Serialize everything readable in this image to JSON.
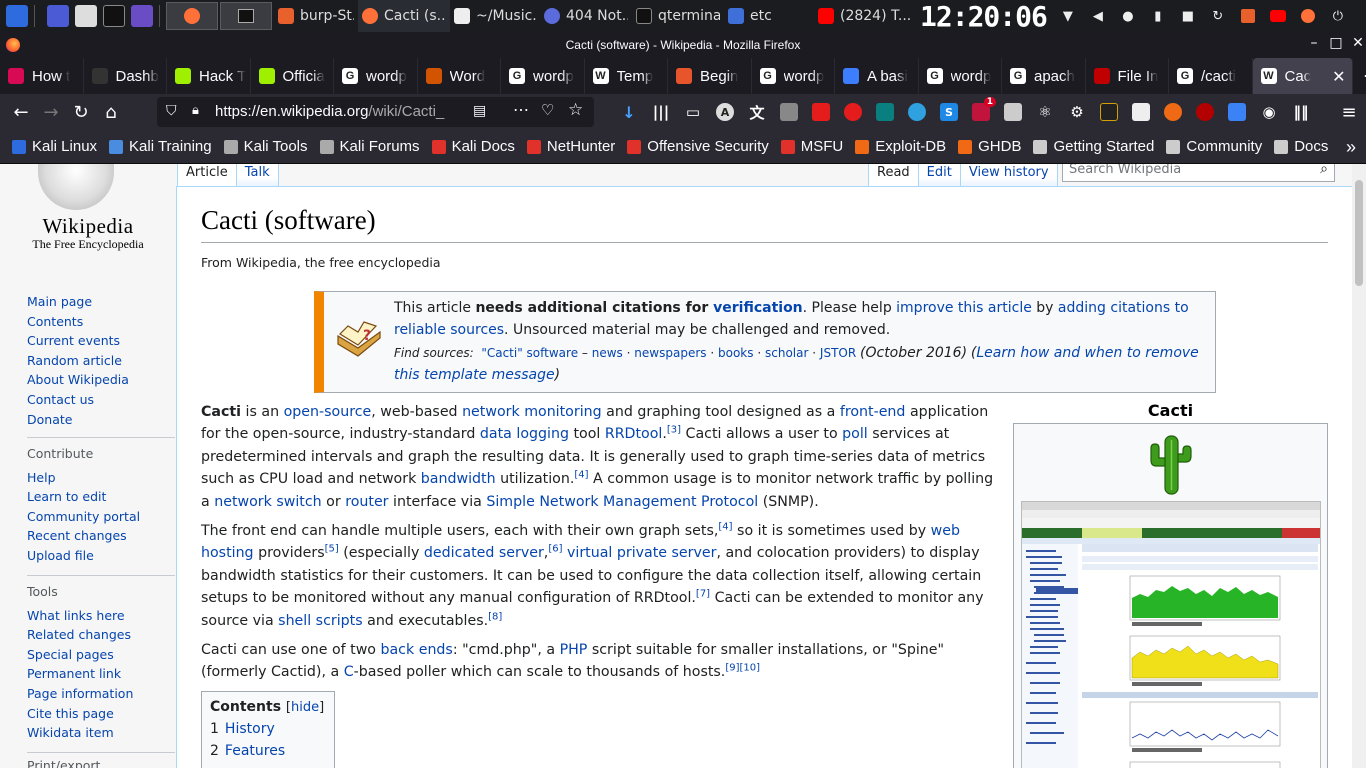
{
  "taskbar": {
    "tasks": [
      {
        "label": "burp-St...",
        "badge": "2"
      },
      {
        "label": "Cacti (s..."
      },
      {
        "label": "~/Music..."
      },
      {
        "label": "404 Not..."
      },
      {
        "label": "qterminal",
        "badge": "3"
      },
      {
        "label": "etc"
      },
      {
        "label": "(2824) T..."
      }
    ],
    "clock": "12:20:06"
  },
  "window": {
    "title": "Cacti (software) - Wikipedia - Mozilla Firefox"
  },
  "tabs": [
    {
      "label": "How t",
      "color": "#d70a53",
      "glyph": ""
    },
    {
      "label": "Dashb",
      "color": "#333333",
      "glyph": ""
    },
    {
      "label": "Hack T",
      "color": "#9fef00",
      "glyph": ""
    },
    {
      "label": "Officia",
      "color": "#9fef00",
      "glyph": ""
    },
    {
      "label": "wordp",
      "color": "#ffffff",
      "glyph": "G"
    },
    {
      "label": "Word",
      "color": "#d35400",
      "glyph": ""
    },
    {
      "label": "wordp",
      "color": "#ffffff",
      "glyph": "G"
    },
    {
      "label": "Temp",
      "color": "#ffffff",
      "glyph": "W"
    },
    {
      "label": "Begin",
      "color": "#e8552c",
      "glyph": ""
    },
    {
      "label": "wordp",
      "color": "#ffffff",
      "glyph": "G"
    },
    {
      "label": "A basi",
      "color": "#3d7eff",
      "glyph": ""
    },
    {
      "label": "wordp",
      "color": "#ffffff",
      "glyph": "G"
    },
    {
      "label": "apach",
      "color": "#ffffff",
      "glyph": "G"
    },
    {
      "label": "File In",
      "color": "#c00000",
      "glyph": ""
    },
    {
      "label": "/cacti",
      "color": "#ffffff",
      "glyph": "G"
    },
    {
      "label": "Cac",
      "color": "#ffffff",
      "glyph": "W",
      "active": true
    }
  ],
  "nav": {
    "url_host": "https://en.wikipedia.org",
    "url_path": "/wiki/Cacti_",
    "badge_count": "1"
  },
  "bookmarks": [
    {
      "label": "Kali Linux",
      "color": "#2d6bde"
    },
    {
      "label": "Kali Training",
      "color": "#4a8ce0"
    },
    {
      "label": "Kali Tools",
      "color": "#aaaaaa"
    },
    {
      "label": "Kali Forums",
      "color": "#aaaaaa"
    },
    {
      "label": "Kali Docs",
      "color": "#e0312b"
    },
    {
      "label": "NetHunter",
      "color": "#e0312b"
    },
    {
      "label": "Offensive Security",
      "color": "#e0312b"
    },
    {
      "label": "MSFU",
      "color": "#e0312b"
    },
    {
      "label": "Exploit-DB",
      "color": "#f06a15"
    },
    {
      "label": "GHDB",
      "color": "#f06a15"
    },
    {
      "label": "Getting Started",
      "color": "#cccccc"
    },
    {
      "label": "Community",
      "color": "#cccccc"
    },
    {
      "label": "Docs",
      "color": "#cccccc"
    }
  ],
  "wiki": {
    "wordmark": "Wikipedia",
    "tagline_logo": "The Free Encyclopedia",
    "nav_links": [
      "Main page",
      "Contents",
      "Current events",
      "Random article",
      "About Wikipedia",
      "Contact us",
      "Donate"
    ],
    "contribute_heading": "Contribute",
    "contribute_links": [
      "Help",
      "Learn to edit",
      "Community portal",
      "Recent changes",
      "Upload file"
    ],
    "tools_heading": "Tools",
    "tools_links": [
      "What links here",
      "Related changes",
      "Special pages",
      "Permanent link",
      "Page information",
      "Cite this page",
      "Wikidata item"
    ],
    "print_heading": "Print/export",
    "tab_article": "Article",
    "tab_talk": "Talk",
    "tab_read": "Read",
    "tab_edit": "Edit",
    "tab_history": "View history",
    "search_placeholder": "Search Wikipedia",
    "title": "Cacti (software)",
    "from": "From Wikipedia, the free encyclopedia",
    "ambox": {
      "t1": "This article ",
      "t2": "needs additional citations for ",
      "t3": "verification",
      "t4": ". Please help ",
      "t5": "improve this article",
      "t6": " by ",
      "t7": "adding citations to reliable sources",
      "t8": ". Unsourced material may be challenged and removed.",
      "find": "Find sources:",
      "f1": "\"Cacti\" software",
      "f2": "news",
      "f3": "newspapers",
      "f4": "books",
      "f5": "scholar",
      "f6": "JSTOR",
      "date": "(October 2016)",
      "learn": "Learn how and when to remove this template message"
    },
    "toc_title": "Contents",
    "toc_hide": "hide",
    "toc_items": [
      {
        "n": "1",
        "label": "History"
      },
      {
        "n": "2",
        "label": "Features"
      }
    ],
    "infobox_title": "Cacti"
  }
}
